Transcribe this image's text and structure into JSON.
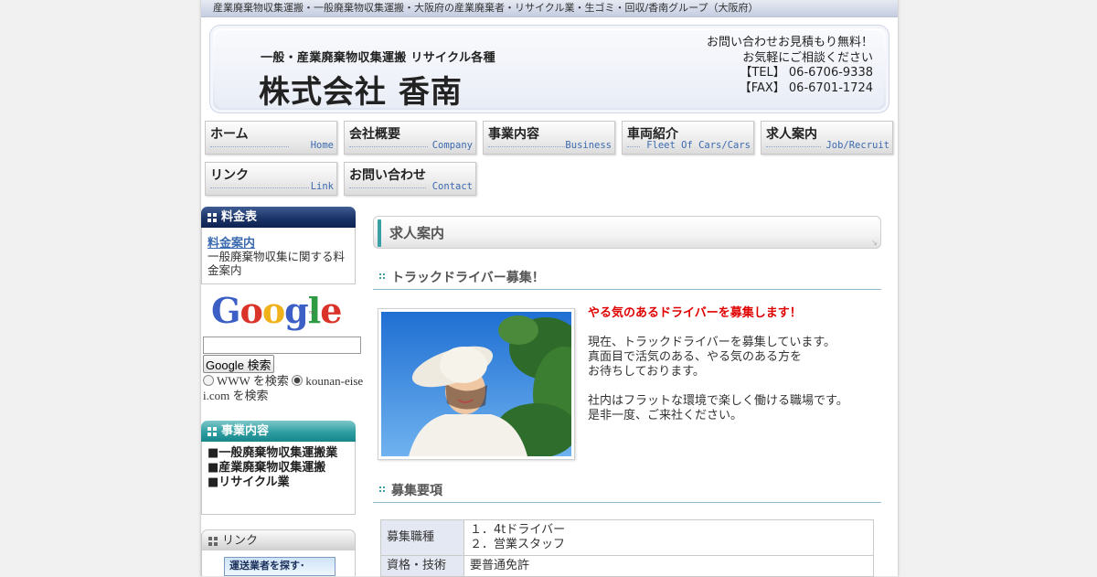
{
  "topbar": "産業廃棄物収集運搬・一般廃棄物収集運搬・大阪府の産業廃棄者・リサイクル業・生ゴミ・回収/香南グループ（大阪府）",
  "header": {
    "tagline": "一般・産業廃棄物収集運搬 リサイクル各種",
    "company": "株式会社 香南",
    "contact": [
      "お問い合わせお見積もり無料！",
      "お気軽にご相談ください",
      "【TEL】 06-6706-9338",
      "【FAX】 06-6701-1724"
    ]
  },
  "nav": [
    {
      "jp": "ホーム",
      "en": "Home"
    },
    {
      "jp": "会社概要",
      "en": "Company"
    },
    {
      "jp": "事業内容",
      "en": "Business"
    },
    {
      "jp": "車両紹介",
      "en": "Fleet Of Cars/Cars"
    },
    {
      "jp": "求人案内",
      "en": "Job/Recruit"
    },
    {
      "jp": "リンク",
      "en": "Link"
    },
    {
      "jp": "お問い合わせ",
      "en": "Contact"
    }
  ],
  "sidebar": {
    "price": {
      "heading": "料金表",
      "link": "料金案内",
      "desc": "一般廃棄物収集に関する料金案内"
    },
    "google": {
      "logo": "Google",
      "button": "Google 検索",
      "opt_www": "WWW を検索",
      "opt_site": "kounan-eisei.com を検索"
    },
    "business": {
      "heading": "事業内容",
      "items": [
        "■一般廃棄物収集運搬業",
        "■産業廃棄物収集運搬",
        "■リサイクル業"
      ]
    },
    "links": {
      "heading": "リンク",
      "banner": "運送業者を探す･"
    }
  },
  "main": {
    "title": "求人案内",
    "section1": "トラックドライバー募集！",
    "headline": "やる気のあるドライバーを募集します！",
    "paragraphs": [
      [
        "現在、トラックドライバーを募集しています。",
        "真面目で活気のある、やる気のある方を",
        "お待ちしております。"
      ],
      [
        "社内はフラットな環境で楽しく働ける職場です。",
        "是非一度、ご来社ください。"
      ]
    ],
    "section2": "募集要項",
    "requirements": [
      {
        "key": "募集職種",
        "values": [
          "１．4tドライバー",
          "２．営業スタッフ"
        ]
      },
      {
        "key": "資格・技術",
        "values": [
          "要普通免許"
        ]
      }
    ]
  },
  "colors": {
    "navy": "#1b3468",
    "teal": "#2f9ea2",
    "accent_red": "#e00000",
    "link_blue": "#3b6ab0"
  }
}
